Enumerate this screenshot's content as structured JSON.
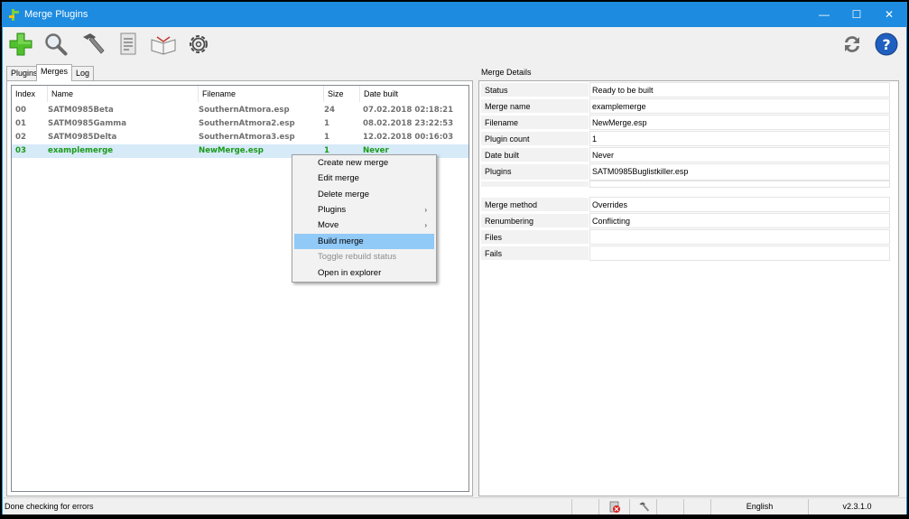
{
  "window": {
    "title": "Merge Plugins",
    "minimize_glyph": "—",
    "maximize_glyph": "☐",
    "close_glyph": "✕",
    "accent_color": "#1d8be0"
  },
  "toolbar": {
    "left_icons": [
      "plus-icon",
      "magnifier-icon",
      "hammer-icon",
      "document-icon",
      "book-icon",
      "gear-icon"
    ],
    "right_icons": [
      "refresh-icon",
      "help-icon"
    ]
  },
  "tabs": [
    "Plugins",
    "Merges",
    "Log"
  ],
  "merges_list": {
    "columns": [
      "Index",
      "Name",
      "Filename",
      "Size",
      "Date built"
    ],
    "rows": [
      {
        "index": "00",
        "name": "SATM0985Beta",
        "filename": "SouthernAtmora.esp",
        "size": "24",
        "date": "07.02.2018 02:18:21"
      },
      {
        "index": "01",
        "name": "SATM0985Gamma",
        "filename": "SouthernAtmora2.esp",
        "size": "1",
        "date": "08.02.2018 23:22:53"
      },
      {
        "index": "02",
        "name": "SATM0985Delta",
        "filename": "SouthernAtmora3.esp",
        "size": "1",
        "date": "12.02.2018 00:16:03"
      },
      {
        "index": "03",
        "name": "examplemerge",
        "filename": "NewMerge.esp",
        "size": "1",
        "date": "Never"
      }
    ],
    "selected_color": "#1a9a1a"
  },
  "context_menu": {
    "items": [
      {
        "label": "Create new merge"
      },
      {
        "label": "Edit merge"
      },
      {
        "label": "Delete merge"
      },
      {
        "label": "Plugins",
        "submenu": "›"
      },
      {
        "label": "Move",
        "submenu": "›"
      },
      {
        "label": "Build merge"
      },
      {
        "label": "Toggle rebuild status"
      },
      {
        "label": "Open in explorer"
      }
    ]
  },
  "details": {
    "title": "Merge Details",
    "rows": [
      {
        "label": "Status",
        "value": "Ready to be built"
      },
      {
        "label": "Merge name",
        "value": "examplemerge"
      },
      {
        "label": "Filename",
        "value": "NewMerge.esp"
      },
      {
        "label": "Plugin count",
        "value": "1"
      },
      {
        "label": "Date built",
        "value": "Never"
      },
      {
        "label": "Plugins",
        "value": "SATM0985Buglistkiller.esp"
      },
      {
        "label": "",
        "value": ""
      },
      {
        "label": "Merge method",
        "value": "Overrides"
      },
      {
        "label": "Renumbering",
        "value": "Conflicting"
      },
      {
        "label": "Files",
        "value": ""
      },
      {
        "label": "Fails",
        "value": ""
      }
    ]
  },
  "statusbar": {
    "message": "Done checking for errors",
    "language": "English",
    "version": "v2.3.1.0"
  }
}
